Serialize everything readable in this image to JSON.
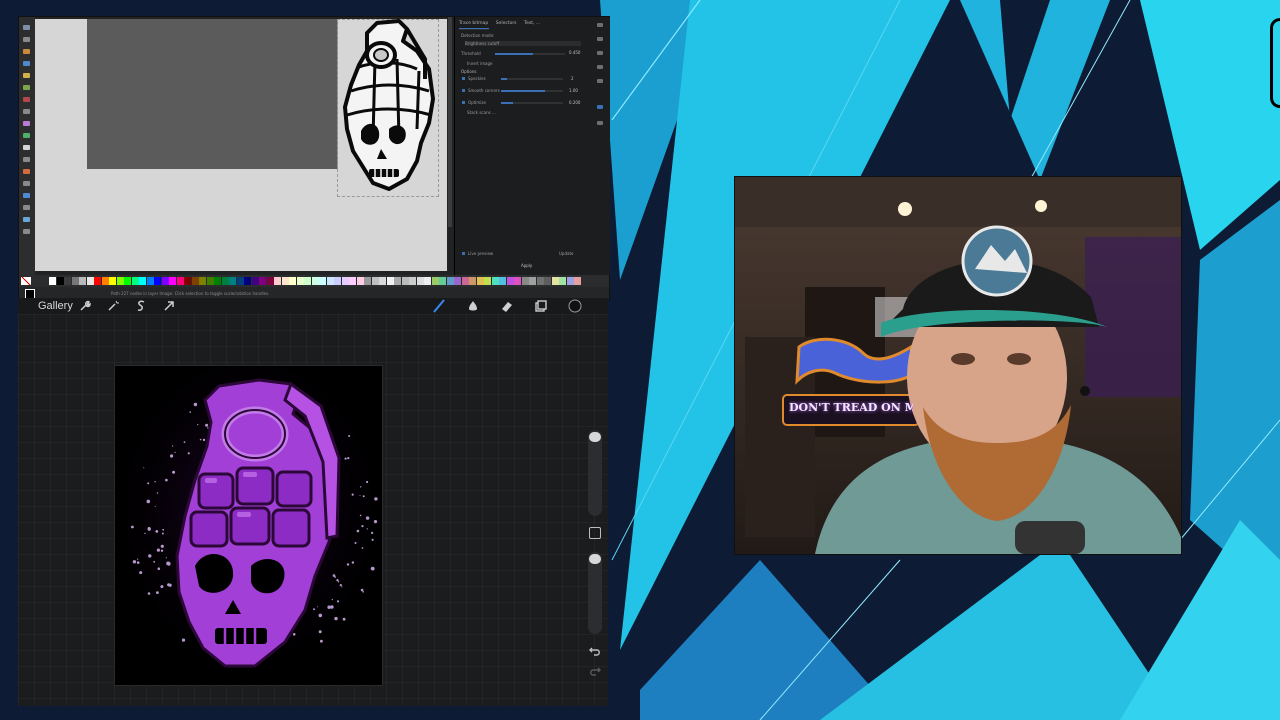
{
  "inkscape": {
    "dialog_tabs": [
      "Trace bitmap",
      "Selectors",
      "Text, ..."
    ],
    "dialog_lines": [
      "Detection mode:",
      "Brightness cutoff",
      "Threshold",
      "Invert image",
      "Options",
      "Speckles",
      "Smooth corners",
      "Optimize",
      "Stack scans ..."
    ],
    "dialog_values": [
      "0.450",
      "2",
      "1.00",
      "0.200"
    ],
    "dialog_footer": {
      "live_preview": "Live preview",
      "update": "Update",
      "apply": "Apply"
    },
    "status_text": "Path 227 nodes in layer Image. Click selection to toggle scale/rotation handles."
  },
  "procreate": {
    "gallery_label": "Gallery",
    "toolbar_left": [
      "wrench-icon",
      "magic-wand-icon",
      "selection-s-icon",
      "move-arrow-icon"
    ],
    "toolbar_right": [
      "brush-icon",
      "smudge-icon",
      "eraser-icon",
      "layers-icon",
      "color-swatch-icon"
    ],
    "active_color": "#111111",
    "brush_accent": "#3a88f2"
  },
  "webcam": {
    "sign_text": "DON'T TREAD ON ME"
  },
  "colors": {
    "inkscape_accent": "#3b6fb6",
    "artwork_purple": "#a23fd6",
    "background_cyan": "#27c9e6"
  }
}
